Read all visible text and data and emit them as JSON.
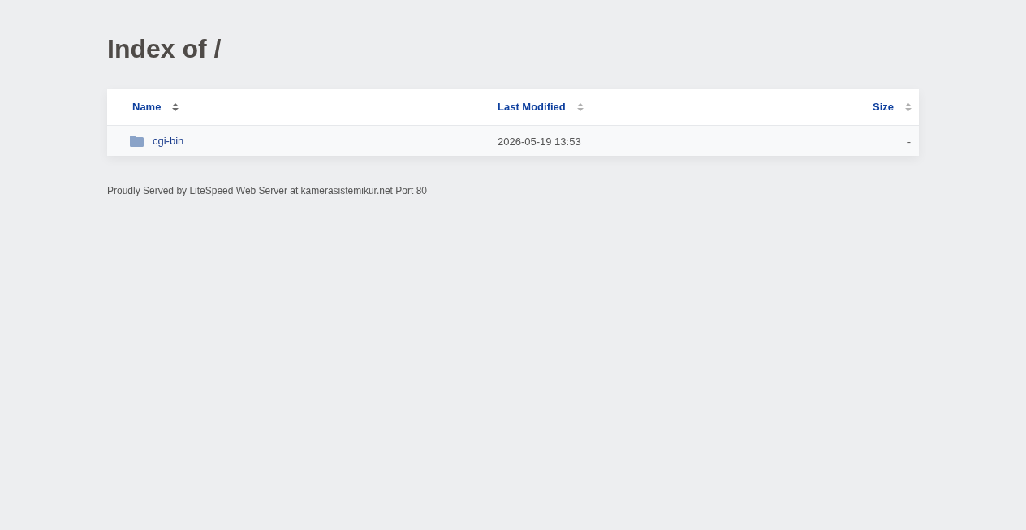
{
  "title": "Index of /",
  "table": {
    "columns": [
      {
        "label": "Name",
        "sorted": true
      },
      {
        "label": "Last Modified",
        "sorted": false
      },
      {
        "label": "Size",
        "sorted": false
      }
    ],
    "rows": [
      {
        "kind": "folder",
        "name": "cgi-bin",
        "last_modified": "2026-05-19 13:53",
        "size": "-"
      }
    ]
  },
  "footer": "Proudly Served by LiteSpeed Web Server at kamerasistemikur.net Port 80"
}
